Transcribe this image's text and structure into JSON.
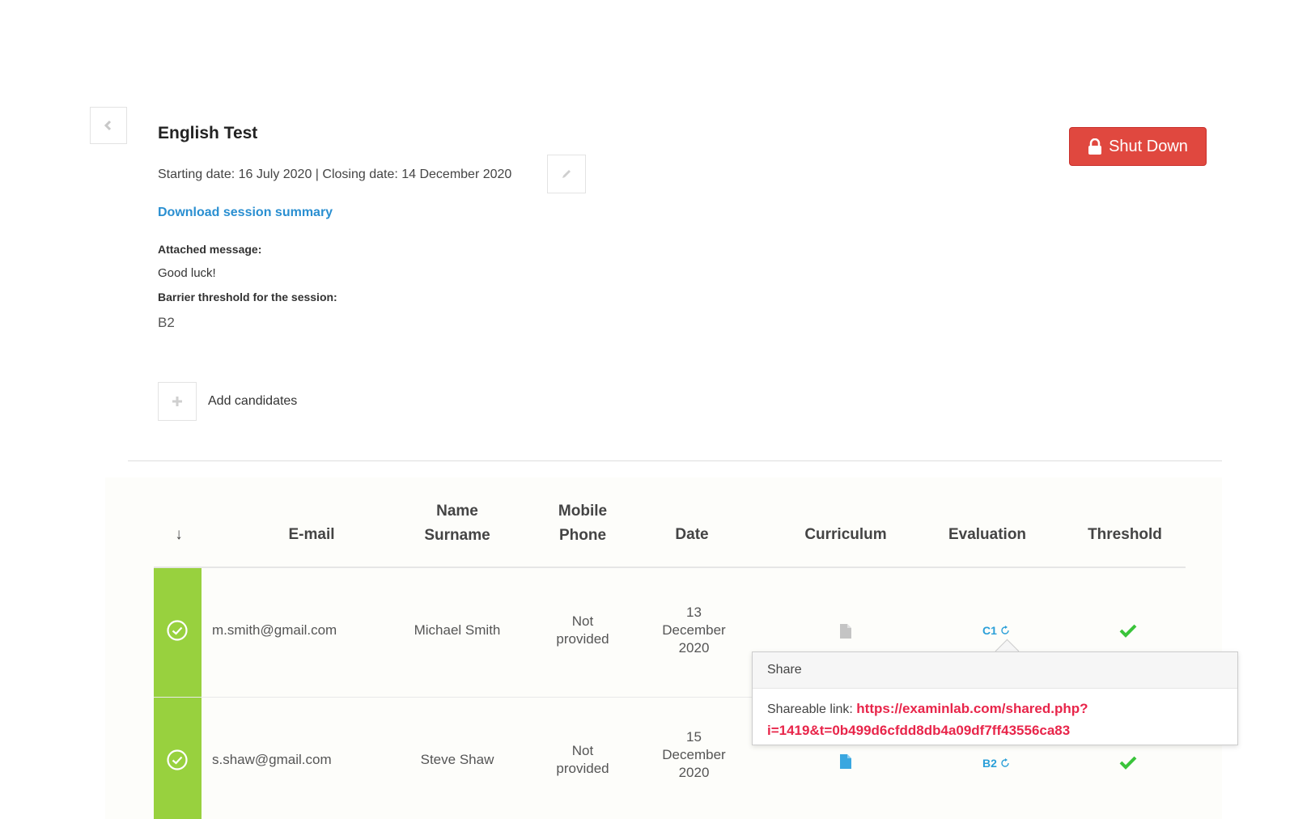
{
  "session": {
    "title": "English Test",
    "dates": "Starting date: 16 July 2020 | Closing date: 14 December 2020",
    "download_link": "Download session summary",
    "attached_label": "Attached message:",
    "attached_message": "Good luck!",
    "threshold_label": "Barrier threshold for the session:",
    "threshold_value": "B2"
  },
  "actions": {
    "add_candidates": "Add candidates",
    "shut_down": "Shut Down"
  },
  "colors": {
    "accent_blue": "#2a8fd1",
    "shutdown_red": "#e0483f",
    "status_green": "#98d13e",
    "link_pink": "#e8254a"
  },
  "table": {
    "sort_arrow": "↓",
    "headers": {
      "email": "E-mail",
      "name_1": "Name",
      "name_2": "Surname",
      "phone_1": "Mobile",
      "phone_2": "Phone",
      "date": "Date",
      "curriculum": "Curriculum",
      "evaluation": "Evaluation",
      "threshold": "Threshold"
    },
    "rows": [
      {
        "email": "m.smith@gmail.com",
        "name": "Michael Smith",
        "phone_1": "Not",
        "phone_2": "provided",
        "date_1": "13",
        "date_2": "December",
        "date_3": "2020",
        "curriculum_icon": "document-icon-grey",
        "evaluation": "C1",
        "threshold_icon": "checkmark-icon"
      },
      {
        "email": "s.shaw@gmail.com",
        "name": "Steve Shaw",
        "phone_1": "Not",
        "phone_2": "provided",
        "date_1": "15",
        "date_2": "December",
        "date_3": "2020",
        "curriculum_icon": "document-icon-blue",
        "evaluation": "B2",
        "threshold_icon": "checkmark-icon"
      }
    ]
  },
  "popover": {
    "title": "Share",
    "label": "Shareable link:",
    "link_line1": "https://examinlab.com/shared.php?",
    "link_line2": "i=1419&t=0b499d6cfdd8db4a09df7ff43556ca83"
  }
}
